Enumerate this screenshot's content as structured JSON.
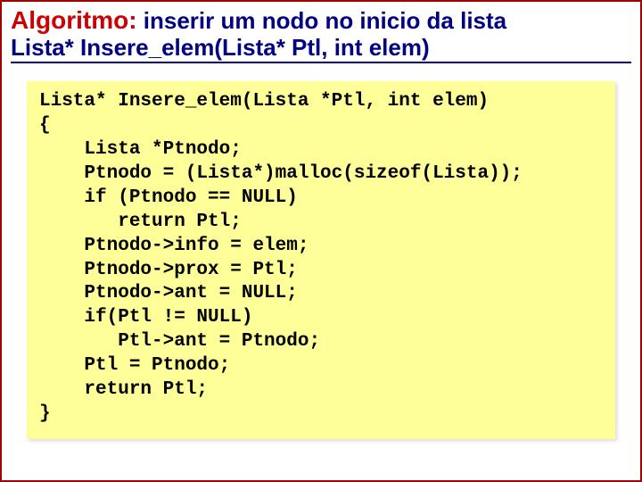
{
  "title": {
    "algo": "Algoritmo:",
    "desc": " inserir um nodo no inicio da lista",
    "sig": "Lista* Insere_elem(Lista* Ptl, int elem)"
  },
  "code": {
    "l0": "Lista* Insere_elem(Lista *Ptl, int elem)",
    "l1": "{",
    "l2": "    Lista *Ptnodo;",
    "l3": "    Ptnodo = (Lista*)malloc(sizeof(Lista));",
    "l4": "    if (Ptnodo == NULL)",
    "l5": "       return Ptl;",
    "l6": "    Ptnodo->info = elem;",
    "l7": "    Ptnodo->prox = Ptl;",
    "l8": "    Ptnodo->ant = NULL;",
    "l9": "    if(Ptl != NULL)",
    "l10": "       Ptl->ant = Ptnodo;",
    "l11": "    Ptl = Ptnodo;",
    "l12": "    return Ptl;",
    "l13": "}"
  }
}
